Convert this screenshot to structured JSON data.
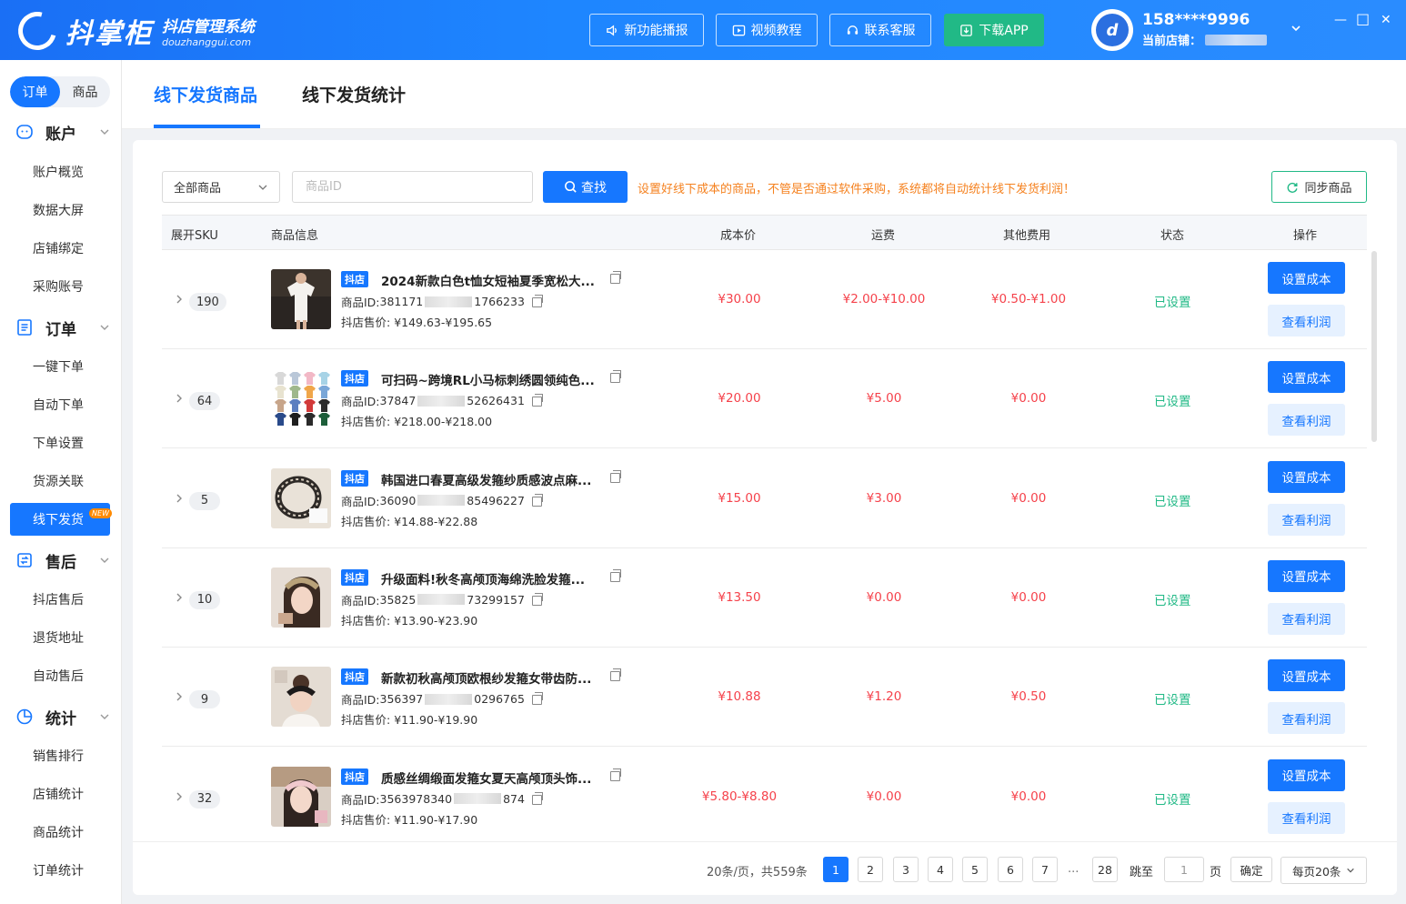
{
  "app": {
    "name": "抖掌柜",
    "subtitle": "抖店管理系统",
    "domain": "douzhanggui.com"
  },
  "header": {
    "buttons": [
      {
        "label": "新功能播报",
        "icon": "speaker-icon"
      },
      {
        "label": "视频教程",
        "icon": "video-icon"
      },
      {
        "label": "联系客服",
        "icon": "headset-icon"
      },
      {
        "label": "下载APP",
        "icon": "download-icon"
      }
    ],
    "user": {
      "phone": "158****9996",
      "shop_label": "当前店铺："
    },
    "window_controls": [
      "—",
      "□",
      "✕"
    ]
  },
  "sidebar": {
    "switch": [
      "订单",
      "商品"
    ],
    "groups": [
      {
        "label": "账户",
        "icon": "account-icon",
        "items": [
          "账户概览",
          "数据大屏",
          "店铺绑定",
          "采购账号"
        ]
      },
      {
        "label": "订单",
        "icon": "order-icon",
        "items": [
          "一键下单",
          "自动下单",
          "下单设置",
          "货源关联",
          "线下发货"
        ]
      },
      {
        "label": "售后",
        "icon": "aftersale-icon",
        "items": [
          "抖店售后",
          "退货地址",
          "自动售后"
        ]
      },
      {
        "label": "统计",
        "icon": "stats-icon",
        "items": [
          "销售排行",
          "店铺统计",
          "商品统计",
          "订单统计"
        ]
      }
    ],
    "active_item": "线下发货",
    "new_badge": "NEW"
  },
  "tabs": [
    "线下发货商品",
    "线下发货统计"
  ],
  "filter": {
    "select_value": "全部商品",
    "input_placeholder": "商品ID",
    "search_label": "查找",
    "tip": "设置好线下成本的商品，不管是否通过软件采购，系统都将自动统计线下发货利润！",
    "sync_label": "同步商品"
  },
  "table": {
    "headers": [
      "展开SKU",
      "商品信息",
      "成本价",
      "运费",
      "其他费用",
      "状态",
      "操作"
    ],
    "id_label": "商品ID: ",
    "price_label": "抖店售价: ",
    "platform_tag": "抖店",
    "op_set": "设置成本",
    "op_view": "查看利润",
    "rows": [
      {
        "sku": "190",
        "title": "2024新款白色t恤女短袖夏季宽松大...",
        "id_pre": "381171",
        "id_post": "1766233",
        "price": "¥149.63-¥195.65",
        "cost": "¥30.00",
        "freight": "¥2.00-¥10.00",
        "other": "¥0.50-¥1.00",
        "status": "已设置"
      },
      {
        "sku": "64",
        "title": "可扫码~跨境RL小马标刺绣圆领纯色...",
        "id_pre": "37847",
        "id_post": "52626431",
        "price": "¥218.00-¥218.00",
        "cost": "¥20.00",
        "freight": "¥5.00",
        "other": "¥0.00",
        "status": "已设置"
      },
      {
        "sku": "5",
        "title": "韩国进口春夏高级发箍纱质感波点麻...",
        "id_pre": "36090",
        "id_post": "85496227",
        "price": "¥14.88-¥22.88",
        "cost": "¥15.00",
        "freight": "¥3.00",
        "other": "¥0.00",
        "status": "已设置"
      },
      {
        "sku": "10",
        "title": "升级面料!秋冬高颅顶海绵洗脸发箍...",
        "id_pre": "35825",
        "id_post": "73299157",
        "price": "¥13.90-¥23.90",
        "cost": "¥13.50",
        "freight": "¥0.00",
        "other": "¥0.00",
        "status": "已设置"
      },
      {
        "sku": "9",
        "title": "新款初秋高颅顶欧根纱发箍女带齿防...",
        "id_pre": "356397",
        "id_post": "0296765",
        "price": "¥11.90-¥19.90",
        "cost": "¥10.88",
        "freight": "¥1.20",
        "other": "¥0.50",
        "status": "已设置"
      },
      {
        "sku": "32",
        "title": "质感丝绸缎面发箍女夏天高颅顶头饰...",
        "id_pre": "3563978340",
        "id_post": "874",
        "price": "¥11.90-¥17.90",
        "cost": "¥5.80-¥8.80",
        "freight": "¥0.00",
        "other": "¥0.00",
        "status": "已设置"
      }
    ]
  },
  "pagination": {
    "total_text": "20条/页，共559条",
    "pages": [
      "1",
      "2",
      "3",
      "4",
      "5",
      "6",
      "7",
      "28"
    ],
    "current": "1",
    "ellipsis": "...",
    "jump_label": "跳至",
    "page_unit": "页",
    "jump_value": "1",
    "ok_label": "确定",
    "per_page": "每页20条"
  },
  "colors": {
    "primary": "#1677ff",
    "price": "#f5424b",
    "success": "#21b986",
    "tip": "#f58220"
  }
}
